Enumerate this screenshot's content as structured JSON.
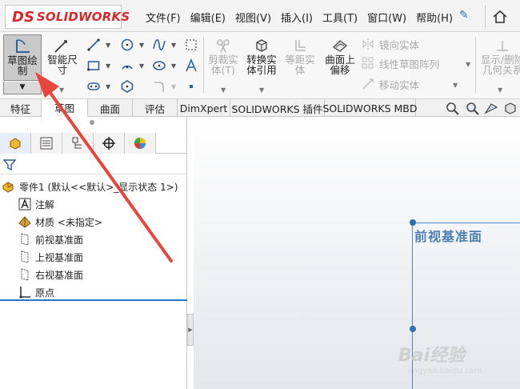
{
  "titlebar": {
    "logo_mark": "DS",
    "logo_text": "SOLIDWORKS",
    "menu": [
      "文件(F)",
      "编辑(E)",
      "视图(V)",
      "插入(I)",
      "工具(T)",
      "窗口(W)",
      "帮助(H)"
    ]
  },
  "commands": {
    "sketch": [
      "草图绘",
      "制"
    ],
    "smart_dim": [
      "智能尺",
      "寸"
    ],
    "trim": [
      "剪裁实",
      "体(T)"
    ],
    "convert": [
      "转换实",
      "体引用"
    ],
    "offset_dist": [
      "等距实",
      "体"
    ],
    "surface_offset": [
      "曲面上",
      "偏移"
    ],
    "mirror": "镜向实体",
    "linear_pattern": "线性草图阵列",
    "move": "移动实体",
    "display_delete": [
      "显示/删除",
      "几何关系"
    ]
  },
  "tabs": [
    "特征",
    "草图",
    "曲面",
    "评估",
    "DimXpert",
    "SOLIDWORKS 插件",
    "SOLIDWORKS MBD"
  ],
  "tree": {
    "part": "零件1  (默认<<默认>_显示状态 1>)",
    "items": [
      "注解",
      "材质 <未指定>",
      "前视基准面",
      "上视基准面",
      "右视基准面",
      "原点"
    ]
  },
  "graphics": {
    "plane_label": "前视基准面"
  },
  "watermark": {
    "text": "Bai经验",
    "sub": "jingyan.baidu.com"
  },
  "colors": {
    "brand_red": "#d9262b",
    "plane_blue": "#4a7fb4",
    "annotation_red": "#e8463c"
  }
}
